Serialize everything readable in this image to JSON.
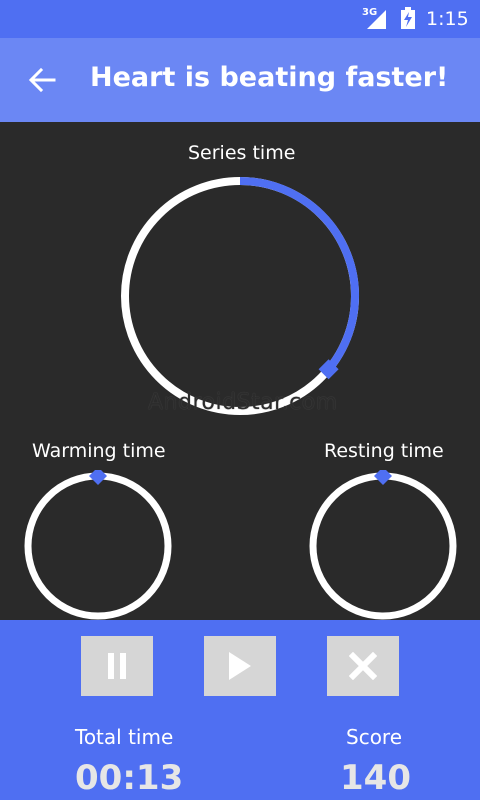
{
  "status_bar": {
    "network": "3G",
    "time": "1:15",
    "icons": [
      "signal-icon",
      "battery-charging-icon"
    ]
  },
  "app_bar": {
    "title": "Heart is beating faster!",
    "back_icon": "arrow-back-icon"
  },
  "timers": {
    "series": {
      "label": "Series time",
      "progress": 0.36
    },
    "warming": {
      "label": "Warming time",
      "progress": 0.0
    },
    "resting": {
      "label": "Resting time",
      "progress": 0.0
    }
  },
  "watermark": "AndroidStar.com",
  "controls": {
    "buttons": [
      {
        "name": "pause-button",
        "icon": "pause-icon"
      },
      {
        "name": "play-button",
        "icon": "play-icon"
      },
      {
        "name": "stop-button",
        "icon": "close-icon"
      }
    ]
  },
  "stats": {
    "total_time_label": "Total time",
    "total_time_value": "00:13",
    "score_label": "Score",
    "score_value": "140"
  },
  "colors": {
    "accent": "#4f6ff2",
    "app_bar": "#6b87f4",
    "background": "#2a2a2a",
    "ring": "#ffffff"
  }
}
